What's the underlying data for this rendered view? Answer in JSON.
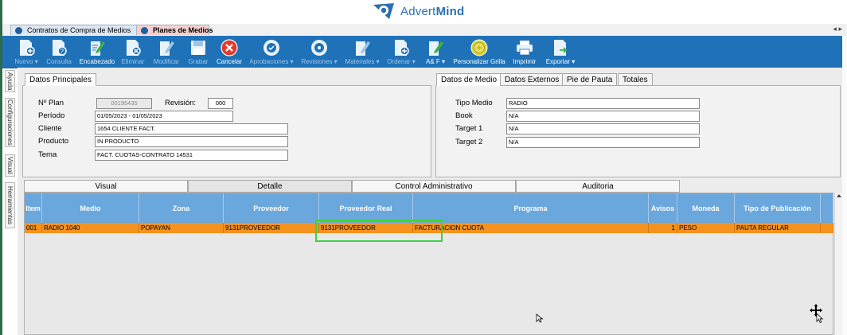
{
  "brand": {
    "name_light": "Advert",
    "name_bold": "Mind",
    "accent": "#2a6fb0"
  },
  "doc_tabs": [
    {
      "label": "Contratos de Compra de Medios",
      "active": false
    },
    {
      "label": "Planes de Medios",
      "active": true
    }
  ],
  "tab_nav": {
    "prev": "◂",
    "next": "▸"
  },
  "toolbar": {
    "nuevo": "Nuevo ▾",
    "consulta": "Consulta",
    "encabezado": "Encabezado",
    "eliminar": "Eliminar",
    "modificar": "Modificar",
    "grabar": "Grabar",
    "cancelar": "Cancelar",
    "aprobaciones": "Aprobaciones ▾",
    "revisiones": "Revisiones ▾",
    "materiales": "Materiales ▾",
    "ordenar": "Ordenar ▾",
    "ayf": "A& F ▾",
    "personalizar": "Personalizar Grilla",
    "imprimir": "Imprimir",
    "exportar": "Exportar ▾"
  },
  "side_tabs": [
    "Ayuda",
    "Configuraciones",
    "Visual",
    "Herramientas"
  ],
  "datos_principales": {
    "tab": "Datos Principales",
    "plan_label": "Nº Plan",
    "plan_value": "00195435",
    "revision_label": "Revisión:",
    "revision_value": "000",
    "periodo_label": "Período",
    "periodo_value": "01/05/2023 - 01/05/2023",
    "cliente_label": "Cliente",
    "cliente_value": "1654 CLIENTE FACT.",
    "producto_label": "Producto",
    "producto_value": "IN PRODUCTO",
    "tema_label": "Tema",
    "tema_value": "FACT. CUOTAS-CONTRATO 14531"
  },
  "datos_medio": {
    "tabs": [
      "Datos de Medio",
      "Datos Externos",
      "Pie de Pauta",
      "Totales"
    ],
    "tipo_label": "Tipo Medio",
    "tipo_value": "RADIO",
    "book_label": "Book",
    "book_value": "N/A",
    "t1_label": "Target 1",
    "t1_value": "N/A",
    "t2_label": "Target 2",
    "t2_value": "N/A"
  },
  "bottom_tabs": [
    "Visual",
    "Detalle",
    "Control Administrativo",
    "Auditoria"
  ],
  "grid": {
    "headers": [
      "Item",
      "Medio",
      "Zona",
      "Proveedor",
      "Proveedor Real",
      "Programa",
      "Avisos",
      "Moneda",
      "Tipo de Publicación"
    ],
    "row": [
      "001",
      "RADIO 1040",
      "POPAYAN",
      "9131PROVEEDOR",
      "9131PROVEEDOR",
      "FACTURACION CUOTA",
      "1",
      "PESO",
      "PAUTA REGULAR"
    ],
    "row_color": "#f6921e",
    "header_color": "#6aa7dd"
  }
}
